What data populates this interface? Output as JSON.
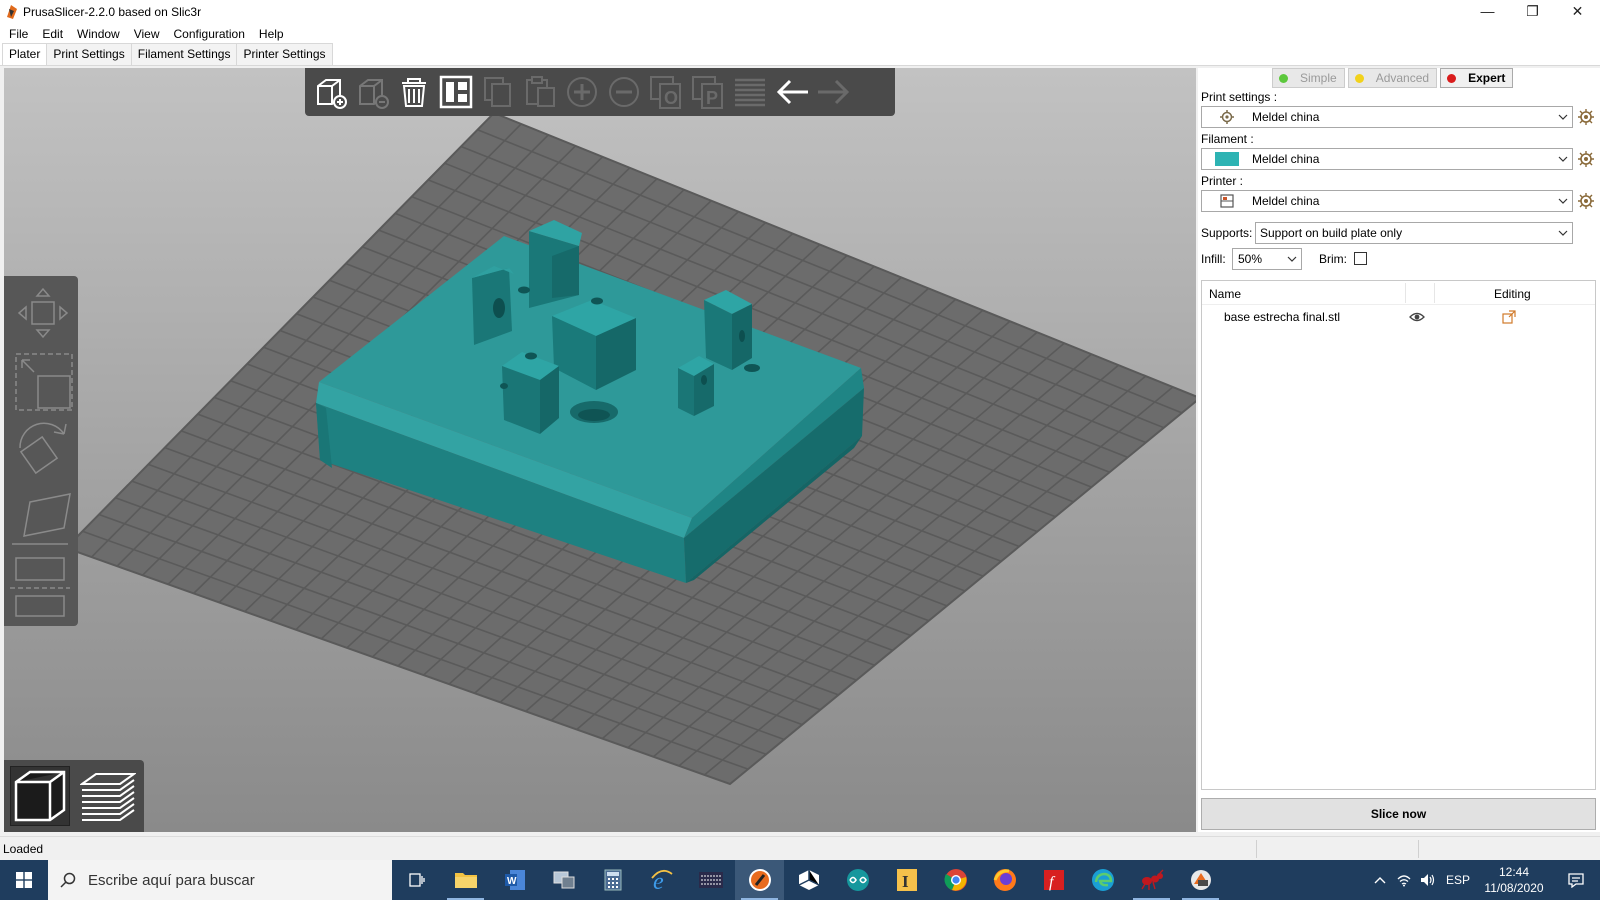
{
  "window": {
    "title": "PrusaSlicer-2.2.0 based on Slic3r",
    "minimize": "—",
    "maximize": "❐",
    "close": "✕"
  },
  "menu": [
    "File",
    "Edit",
    "Window",
    "View",
    "Configuration",
    "Help"
  ],
  "tabs": [
    "Plater",
    "Print Settings",
    "Filament Settings",
    "Printer Settings"
  ],
  "modes": {
    "simple": "Simple",
    "advanced": "Advanced",
    "expert": "Expert",
    "colors": {
      "simple": "#5cc83c",
      "advanced": "#f2d21c",
      "expert": "#d91c1c"
    }
  },
  "sidebar": {
    "print_label": "Print settings :",
    "print_value": "Meldel china",
    "filament_label": "Filament :",
    "filament_value": "Meldel china",
    "filament_color": "#2db3b3",
    "printer_label": "Printer :",
    "printer_value": "Meldel china",
    "supports_label": "Supports:",
    "supports_value": "Support on build plate only",
    "infill_label": "Infill:",
    "infill_value": "50%",
    "brim_label": "Brim:",
    "brim_checked": false,
    "list_header_name": "Name",
    "list_header_editing": "Editing",
    "objects": [
      {
        "name": "base estrecha final.stl"
      }
    ],
    "slice_button": "Slice now"
  },
  "status": {
    "text": "Loaded"
  },
  "taskbar": {
    "search_placeholder": "Escribe aquí para buscar",
    "language": "ESP",
    "time": "12:44",
    "date": "11/08/2020",
    "apps": [
      "task-view",
      "file-explorer",
      "word",
      "computer",
      "calculator",
      "internet-explorer",
      "photo-app",
      "prusaslicer",
      "3d-builder",
      "arduino",
      "notepad-i",
      "chrome",
      "firefox",
      "flash",
      "edge",
      "ant-app",
      "prusa-app"
    ]
  },
  "model_color": "#1f8a8a"
}
